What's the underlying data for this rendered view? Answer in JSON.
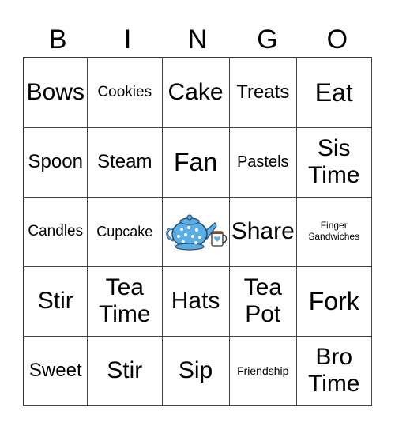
{
  "header": [
    "B",
    "I",
    "N",
    "G",
    "O"
  ],
  "cells": [
    [
      "Bows",
      "Cookies",
      "Cake",
      "Treats",
      "Eat"
    ],
    [
      "Spoon",
      "Steam",
      "Fan",
      "Pastels",
      "Sis Time"
    ],
    [
      "Candles",
      "Cupcake",
      "",
      "Share",
      "Finger Sandwiches"
    ],
    [
      "Stir",
      "Tea Time",
      "Hats",
      "Tea Pot",
      "Fork"
    ],
    [
      "Sweet",
      "Stir",
      "Sip",
      "Friendship",
      "Bro Time"
    ]
  ],
  "free_space": {
    "icon": "teapot-and-cup-icon"
  },
  "colors": {
    "teapot": "#5aaee8",
    "line": "#444444"
  }
}
